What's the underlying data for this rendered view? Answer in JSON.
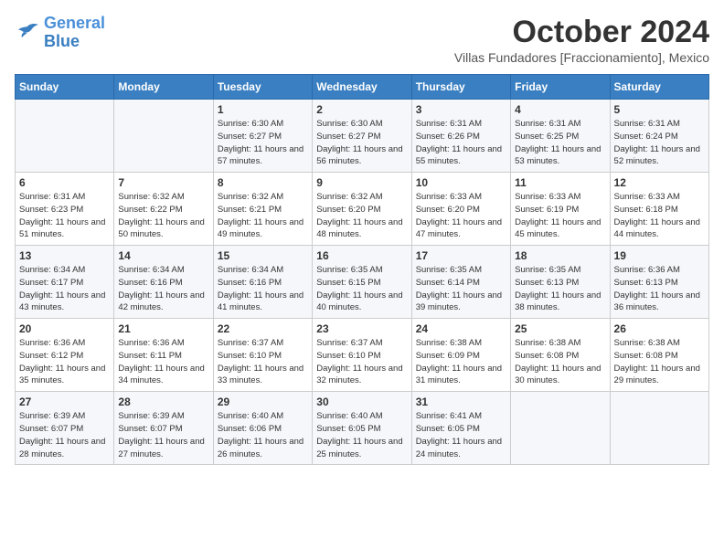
{
  "logo": {
    "line1": "General",
    "line2": "Blue"
  },
  "title": "October 2024",
  "location": "Villas Fundadores [Fraccionamiento], Mexico",
  "days_of_week": [
    "Sunday",
    "Monday",
    "Tuesday",
    "Wednesday",
    "Thursday",
    "Friday",
    "Saturday"
  ],
  "weeks": [
    [
      {
        "day": "",
        "info": ""
      },
      {
        "day": "",
        "info": ""
      },
      {
        "day": "1",
        "sunrise": "6:30 AM",
        "sunset": "6:27 PM",
        "daylight": "11 hours and 57 minutes."
      },
      {
        "day": "2",
        "sunrise": "6:30 AM",
        "sunset": "6:27 PM",
        "daylight": "11 hours and 56 minutes."
      },
      {
        "day": "3",
        "sunrise": "6:31 AM",
        "sunset": "6:26 PM",
        "daylight": "11 hours and 55 minutes."
      },
      {
        "day": "4",
        "sunrise": "6:31 AM",
        "sunset": "6:25 PM",
        "daylight": "11 hours and 53 minutes."
      },
      {
        "day": "5",
        "sunrise": "6:31 AM",
        "sunset": "6:24 PM",
        "daylight": "11 hours and 52 minutes."
      }
    ],
    [
      {
        "day": "6",
        "sunrise": "6:31 AM",
        "sunset": "6:23 PM",
        "daylight": "11 hours and 51 minutes."
      },
      {
        "day": "7",
        "sunrise": "6:32 AM",
        "sunset": "6:22 PM",
        "daylight": "11 hours and 50 minutes."
      },
      {
        "day": "8",
        "sunrise": "6:32 AM",
        "sunset": "6:21 PM",
        "daylight": "11 hours and 49 minutes."
      },
      {
        "day": "9",
        "sunrise": "6:32 AM",
        "sunset": "6:20 PM",
        "daylight": "11 hours and 48 minutes."
      },
      {
        "day": "10",
        "sunrise": "6:33 AM",
        "sunset": "6:20 PM",
        "daylight": "11 hours and 47 minutes."
      },
      {
        "day": "11",
        "sunrise": "6:33 AM",
        "sunset": "6:19 PM",
        "daylight": "11 hours and 45 minutes."
      },
      {
        "day": "12",
        "sunrise": "6:33 AM",
        "sunset": "6:18 PM",
        "daylight": "11 hours and 44 minutes."
      }
    ],
    [
      {
        "day": "13",
        "sunrise": "6:34 AM",
        "sunset": "6:17 PM",
        "daylight": "11 hours and 43 minutes."
      },
      {
        "day": "14",
        "sunrise": "6:34 AM",
        "sunset": "6:16 PM",
        "daylight": "11 hours and 42 minutes."
      },
      {
        "day": "15",
        "sunrise": "6:34 AM",
        "sunset": "6:16 PM",
        "daylight": "11 hours and 41 minutes."
      },
      {
        "day": "16",
        "sunrise": "6:35 AM",
        "sunset": "6:15 PM",
        "daylight": "11 hours and 40 minutes."
      },
      {
        "day": "17",
        "sunrise": "6:35 AM",
        "sunset": "6:14 PM",
        "daylight": "11 hours and 39 minutes."
      },
      {
        "day": "18",
        "sunrise": "6:35 AM",
        "sunset": "6:13 PM",
        "daylight": "11 hours and 38 minutes."
      },
      {
        "day": "19",
        "sunrise": "6:36 AM",
        "sunset": "6:13 PM",
        "daylight": "11 hours and 36 minutes."
      }
    ],
    [
      {
        "day": "20",
        "sunrise": "6:36 AM",
        "sunset": "6:12 PM",
        "daylight": "11 hours and 35 minutes."
      },
      {
        "day": "21",
        "sunrise": "6:36 AM",
        "sunset": "6:11 PM",
        "daylight": "11 hours and 34 minutes."
      },
      {
        "day": "22",
        "sunrise": "6:37 AM",
        "sunset": "6:10 PM",
        "daylight": "11 hours and 33 minutes."
      },
      {
        "day": "23",
        "sunrise": "6:37 AM",
        "sunset": "6:10 PM",
        "daylight": "11 hours and 32 minutes."
      },
      {
        "day": "24",
        "sunrise": "6:38 AM",
        "sunset": "6:09 PM",
        "daylight": "11 hours and 31 minutes."
      },
      {
        "day": "25",
        "sunrise": "6:38 AM",
        "sunset": "6:08 PM",
        "daylight": "11 hours and 30 minutes."
      },
      {
        "day": "26",
        "sunrise": "6:38 AM",
        "sunset": "6:08 PM",
        "daylight": "11 hours and 29 minutes."
      }
    ],
    [
      {
        "day": "27",
        "sunrise": "6:39 AM",
        "sunset": "6:07 PM",
        "daylight": "11 hours and 28 minutes."
      },
      {
        "day": "28",
        "sunrise": "6:39 AM",
        "sunset": "6:07 PM",
        "daylight": "11 hours and 27 minutes."
      },
      {
        "day": "29",
        "sunrise": "6:40 AM",
        "sunset": "6:06 PM",
        "daylight": "11 hours and 26 minutes."
      },
      {
        "day": "30",
        "sunrise": "6:40 AM",
        "sunset": "6:05 PM",
        "daylight": "11 hours and 25 minutes."
      },
      {
        "day": "31",
        "sunrise": "6:41 AM",
        "sunset": "6:05 PM",
        "daylight": "11 hours and 24 minutes."
      },
      {
        "day": "",
        "info": ""
      },
      {
        "day": "",
        "info": ""
      }
    ]
  ]
}
